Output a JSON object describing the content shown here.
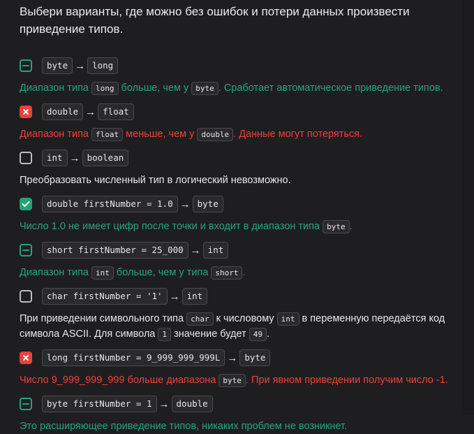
{
  "question": "Выбери варианты, где можно без ошибок и потери данных произвести приведение типов.",
  "arrow": "→",
  "icons": {
    "unchecked": "checkbox-empty-icon",
    "partial": "checkbox-dash-icon",
    "wrong": "cross-icon",
    "correct": "checkmark-icon"
  },
  "colors": {
    "green": "#26a67a",
    "red": "#ef4136",
    "background": "#1e1e20"
  },
  "options": [
    {
      "from": "byte",
      "to": "long",
      "state": "partial",
      "exp_p0": "Диапазон типа",
      "exp_c1": "long",
      "exp_p1": "больше, чем у",
      "exp_c2": "byte",
      "exp_p2": ". Сработает автоматическое приведение типов."
    },
    {
      "from": "double",
      "to": "float",
      "state": "wrong",
      "exp_p0": "Диапазон типа",
      "exp_c1": "float",
      "exp_p1": "меньше, чем у",
      "exp_c2": "double",
      "exp_p2": ". Данные могут потеряться."
    },
    {
      "from": "int",
      "to": "boolean",
      "state": "unchecked",
      "exp_text": "Преобразовать численный тип в логический невозможно."
    },
    {
      "from": "double firstNumber = 1.0",
      "to": "byte",
      "state": "correct",
      "exp_p0": "Число 1.0 не имеет цифр после точки и входит в диапазон типа",
      "exp_c1": "byte",
      "exp_p1": "."
    },
    {
      "from": "short firstNumber = 25_000",
      "to": "int",
      "state": "partial",
      "exp_p0": "Диапазон типа",
      "exp_c1": "int",
      "exp_p1": "больше, чем у типа",
      "exp_c2": "short",
      "exp_p2": "."
    },
    {
      "from": "char firstNumber = '1'",
      "to": "int",
      "state": "unchecked",
      "exp_p0": "При приведении символьного типа",
      "exp_c1": "char",
      "exp_p1": "к числовому",
      "exp_c2": "int",
      "exp_p2": "в переменную передаётся код символа ASCII. Для символа",
      "exp_c3": "1",
      "exp_p3": "значение будет",
      "exp_c4": "49",
      "exp_p4": "."
    },
    {
      "from": "long firstNumber = 9_999_999_999L",
      "to": "byte",
      "state": "wrong",
      "exp_p0": "Число 9_999_999_999 больше диапазона",
      "exp_c1": "byte",
      "exp_p1": ". При явном приведении получим число -1."
    },
    {
      "from": "byte firstNumber = 1",
      "to": "double",
      "state": "partial",
      "exp_text": "Это расширяющее приведение типов, никаких проблем не возникнет."
    }
  ]
}
